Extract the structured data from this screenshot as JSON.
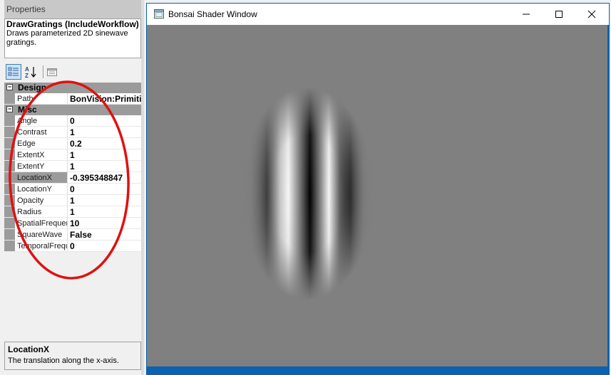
{
  "properties_panel": {
    "header": "Properties",
    "description": {
      "title": "DrawGratings (IncludeWorkflow)",
      "text": "Draws parameterized 2D sinewave gratings."
    },
    "toolbar": {
      "categorized_icon": "categorized-icon",
      "alphabetical_icon": "sort-az-icon",
      "property_pages_icon": "property-pages-icon"
    },
    "categories": [
      {
        "name": "Design",
        "expander": "⊟",
        "properties": [
          {
            "name": "Path",
            "value": "BonVision:Primitiv"
          }
        ]
      },
      {
        "name": "Misc",
        "expander": "⊟",
        "properties": [
          {
            "name": "Angle",
            "value": "0"
          },
          {
            "name": "Contrast",
            "value": "1"
          },
          {
            "name": "Edge",
            "value": "0.2"
          },
          {
            "name": "ExtentX",
            "value": "1"
          },
          {
            "name": "ExtentY",
            "value": "1"
          },
          {
            "name": "LocationX",
            "value": "-0.395348847"
          },
          {
            "name": "LocationY",
            "value": "0"
          },
          {
            "name": "Opacity",
            "value": "1"
          },
          {
            "name": "Radius",
            "value": "1"
          },
          {
            "name": "SpatialFrequer",
            "value": "10"
          },
          {
            "name": "SquareWave",
            "value": "False"
          },
          {
            "name": "TemporalFrequ",
            "value": "0"
          }
        ]
      }
    ],
    "help": {
      "title": "LocationX",
      "text": "The translation along the x-axis."
    }
  },
  "shader_window": {
    "title": "Bonsai Shader Window",
    "controls": {
      "minimize_icon": "minimize-icon",
      "maximize_icon": "maximize-icon",
      "close_icon": "close-icon"
    },
    "background_color": "#808080",
    "frame_color": "#0a62b0"
  },
  "annotation_color": "#e01010"
}
